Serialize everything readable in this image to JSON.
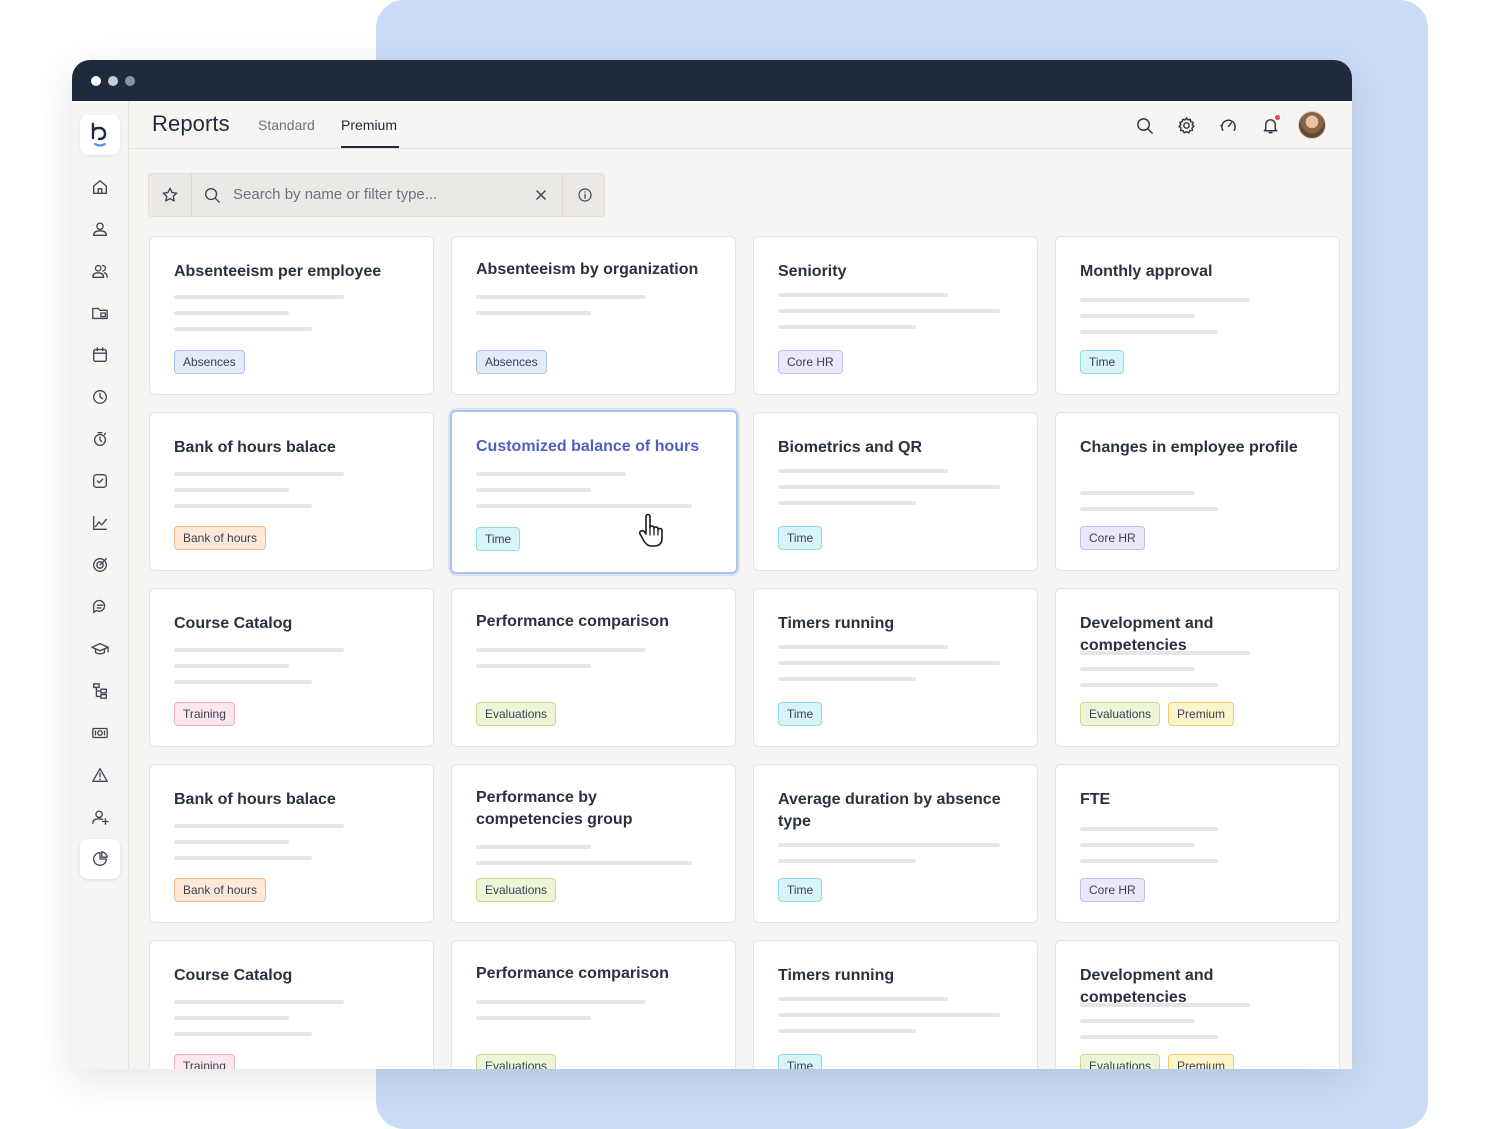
{
  "window": {
    "controls": [
      "close",
      "minimize",
      "maximize"
    ],
    "dot_colors": [
      "#ffffff",
      "#c8ccd4",
      "#8a93a3"
    ]
  },
  "header": {
    "title": "Reports",
    "tabs": [
      {
        "label": "Standard",
        "active": false
      },
      {
        "label": "Premium",
        "active": true
      }
    ],
    "icons": [
      "search-icon",
      "settings-icon",
      "speed-icon",
      "bell-icon",
      "avatar"
    ]
  },
  "sidebar": {
    "logo": "b",
    "items": [
      "home-icon",
      "user-icon",
      "users-icon",
      "folder-icon",
      "calendar-icon",
      "clock-icon",
      "timer-icon",
      "checkbox-icon",
      "chart-icon",
      "target-icon",
      "chat-icon",
      "graduation-icon",
      "org-icon",
      "money-icon",
      "alert-icon",
      "user-add-icon",
      "pie-chart-icon"
    ],
    "active": "pie-chart-icon"
  },
  "search": {
    "placeholder": "Search by name or filter type..."
  },
  "colors": {
    "accent": "#4f5fbf",
    "header_bar": "#1f2a3d",
    "backdrop": "#c9dcf6",
    "notification": "#ef4444"
  },
  "cards": [
    {
      "title": "Absenteeism per employee",
      "tags": [
        {
          "label": "Absences",
          "kind": "absences"
        }
      ]
    },
    {
      "title": "Absenteeism by organization",
      "tags": [
        {
          "label": "Absences",
          "kind": "absences"
        }
      ]
    },
    {
      "title": "Seniority",
      "tags": [
        {
          "label": "Core HR",
          "kind": "corehr"
        }
      ]
    },
    {
      "title": "Monthly approval",
      "tags": [
        {
          "label": "Time",
          "kind": "time"
        }
      ]
    },
    {
      "title": "Bank of hours balace",
      "tags": [
        {
          "label": "Bank of hours",
          "kind": "bank"
        }
      ]
    },
    {
      "title": "Customized balance of hours",
      "tags": [
        {
          "label": "Time",
          "kind": "time"
        }
      ],
      "hovered": true
    },
    {
      "title": "Biometrics and QR",
      "tags": [
        {
          "label": "Time",
          "kind": "time"
        }
      ]
    },
    {
      "title": "Changes in employee profile",
      "tags": [
        {
          "label": "Core HR",
          "kind": "corehr"
        }
      ]
    },
    {
      "title": "Course Catalog",
      "tags": [
        {
          "label": "Training",
          "kind": "training"
        }
      ]
    },
    {
      "title": "Performance comparison",
      "tags": [
        {
          "label": "Evaluations",
          "kind": "evaluations"
        }
      ]
    },
    {
      "title": "Timers running",
      "tags": [
        {
          "label": "Time",
          "kind": "time"
        }
      ]
    },
    {
      "title": "Development and competencies",
      "tags": [
        {
          "label": "Evaluations",
          "kind": "evaluations"
        },
        {
          "label": "Premium",
          "kind": "premium"
        }
      ]
    },
    {
      "title": "Bank of hours balace",
      "tags": [
        {
          "label": "Bank of hours",
          "kind": "bank"
        }
      ]
    },
    {
      "title": "Performance by competencies group",
      "tags": [
        {
          "label": "Evaluations",
          "kind": "evaluations"
        }
      ]
    },
    {
      "title": "Average duration by absence type",
      "tags": [
        {
          "label": "Time",
          "kind": "time"
        }
      ]
    },
    {
      "title": "FTE",
      "tags": [
        {
          "label": "Core HR",
          "kind": "corehr"
        }
      ]
    },
    {
      "title": "Course Catalog",
      "tags": [
        {
          "label": "Training",
          "kind": "training"
        }
      ]
    },
    {
      "title": "Performance comparison",
      "tags": [
        {
          "label": "Evaluations",
          "kind": "evaluations"
        }
      ]
    },
    {
      "title": "Timers running",
      "tags": [
        {
          "label": "Time",
          "kind": "time"
        }
      ]
    },
    {
      "title": "Development and competencies",
      "tags": [
        {
          "label": "Evaluations",
          "kind": "evaluations"
        },
        {
          "label": "Premium",
          "kind": "premium"
        }
      ]
    }
  ]
}
